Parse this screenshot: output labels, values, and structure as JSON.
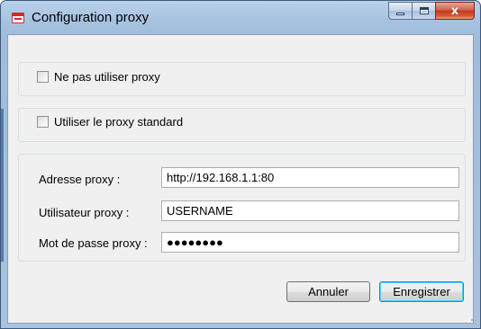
{
  "window": {
    "title": "Configuration proxy",
    "controls": {
      "minimize": "minimize-icon",
      "maximize": "maximize-icon",
      "close": "close-icon"
    }
  },
  "options": {
    "no_proxy": {
      "label": "Ne pas utiliser proxy",
      "checked": false
    },
    "standard_proxy": {
      "label": "Utiliser le proxy standard",
      "checked": false
    }
  },
  "fields": {
    "address": {
      "label": "Adresse proxy :",
      "value": "http://192.168.1.1:80"
    },
    "user": {
      "label": "Utilisateur proxy :",
      "value": "USERNAME"
    },
    "password": {
      "label": "Mot de passe proxy :",
      "value": "●●●●●●●●"
    }
  },
  "buttons": {
    "cancel": "Annuler",
    "save": "Enregistrer"
  }
}
